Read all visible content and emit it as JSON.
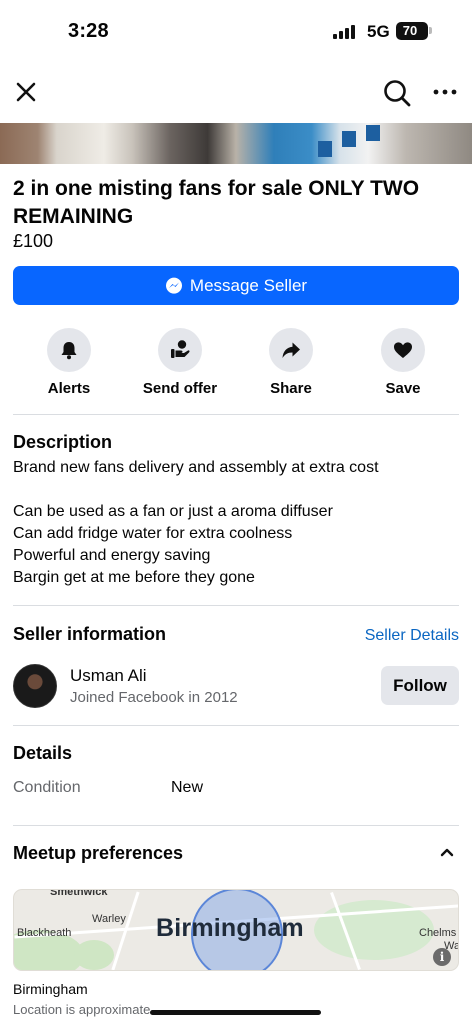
{
  "status": {
    "time": "3:28",
    "network": "5G",
    "battery": "70"
  },
  "listing": {
    "title": "2 in one misting fans for sale ONLY TWO REMAINING",
    "price": "£100",
    "message_button": "Message Seller"
  },
  "actions": [
    {
      "label": "Alerts",
      "icon": "bell-icon"
    },
    {
      "label": "Send offer",
      "icon": "send-offer-icon"
    },
    {
      "label": "Share",
      "icon": "share-icon"
    },
    {
      "label": "Save",
      "icon": "heart-icon"
    }
  ],
  "description": {
    "heading": "Description",
    "lines": [
      "Brand new fans delivery and assembly at extra cost",
      "Can be used as a fan or just a aroma diffuser",
      "Can add fridge water for extra coolness",
      "Powerful and energy saving",
      "Bargin get at me before they gone"
    ]
  },
  "seller": {
    "heading": "Seller information",
    "details_link": "Seller Details",
    "name": "Usman Ali",
    "joined": "Joined Facebook in 2012",
    "follow": "Follow"
  },
  "details": {
    "heading": "Details",
    "condition_label": "Condition",
    "condition_value": "New"
  },
  "meetup": {
    "heading": "Meetup preferences",
    "map": {
      "city": "Birmingham",
      "labels": [
        "Smethwick",
        "Warley",
        "Blackheath",
        "Chelms",
        "Wa"
      ]
    },
    "location": "Birmingham",
    "note": "Location is approximate"
  },
  "colors": {
    "accent": "#0866ff",
    "link": "#0a66c2",
    "muted": "#65676b",
    "chip": "#e4e6eb"
  }
}
